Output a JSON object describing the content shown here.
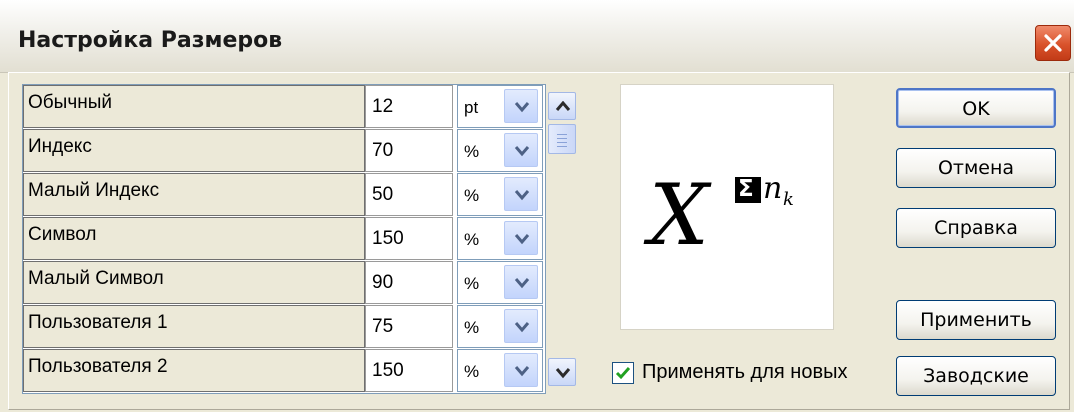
{
  "window": {
    "title": "Настройка Размеров"
  },
  "sizes": [
    {
      "name": "Обычный",
      "value": "12",
      "unit": "pt"
    },
    {
      "name": "Индекс",
      "value": "70",
      "unit": "%"
    },
    {
      "name": "Малый Индекс",
      "value": "50",
      "unit": "%"
    },
    {
      "name": "Символ",
      "value": "150",
      "unit": "%"
    },
    {
      "name": "Малый Символ",
      "value": "90",
      "unit": "%"
    },
    {
      "name": "Пользователя 1",
      "value": "75",
      "unit": "%"
    },
    {
      "name": "Пользователя 2",
      "value": "150",
      "unit": "%"
    }
  ],
  "preview": {
    "base": "X",
    "sigma": "Σ",
    "var": "n",
    "sub": "k"
  },
  "checkbox": {
    "label": "Применять для новых",
    "checked": true
  },
  "buttons": {
    "ok": "OK",
    "cancel": "Отмена",
    "help": "Справка",
    "apply": "Применить",
    "defaults": "Заводские"
  },
  "colors": {
    "title_bar": "#f2f1ec",
    "close_button": "#d9522b",
    "dialog_bg": "#ece9d8",
    "accent": "#4e76c7"
  }
}
